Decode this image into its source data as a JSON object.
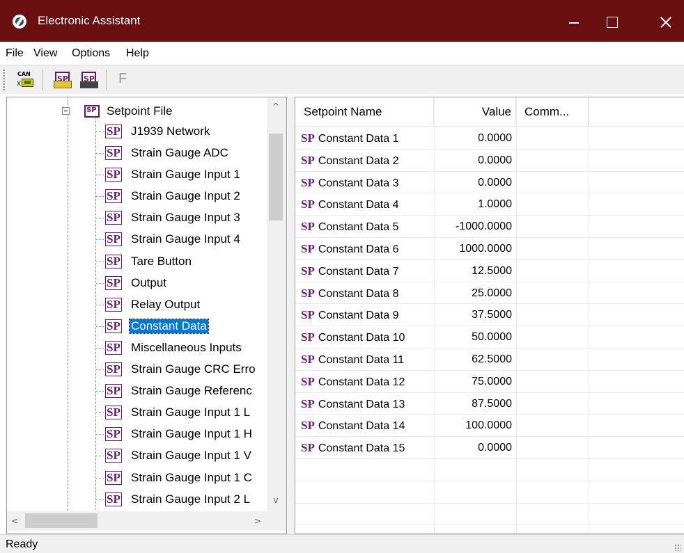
{
  "window": {
    "title": "Electronic Assistant",
    "controls": {
      "minimize": "minimize",
      "maximize": "maximize",
      "close": "close"
    }
  },
  "menu": [
    "File",
    "View",
    "Options",
    "Help"
  ],
  "toolbar": {
    "can_label": "CAN",
    "sp_icon_text": "SP",
    "f_label": "F"
  },
  "tree": {
    "root": {
      "label": "Setpoint File",
      "icon_text": "SP"
    },
    "tag": "SP",
    "items": [
      {
        "label": "J1939 Network"
      },
      {
        "label": "Strain Gauge ADC"
      },
      {
        "label": "Strain Gauge Input 1"
      },
      {
        "label": "Strain Gauge Input 2"
      },
      {
        "label": "Strain Gauge Input 3"
      },
      {
        "label": "Strain Gauge Input 4"
      },
      {
        "label": "Tare Button"
      },
      {
        "label": "Output"
      },
      {
        "label": "Relay Output"
      },
      {
        "label": "Constant Data",
        "selected": true
      },
      {
        "label": "Miscellaneous Inputs"
      },
      {
        "label": "Strain Gauge CRC Erro"
      },
      {
        "label": "Strain Gauge Referenc"
      },
      {
        "label": "Strain Gauge Input 1 L"
      },
      {
        "label": "Strain Gauge Input 1 H"
      },
      {
        "label": "Strain Gauge Input 1 V"
      },
      {
        "label": "Strain Gauge Input 1 C"
      },
      {
        "label": "Strain Gauge Input 2 L"
      }
    ],
    "scroll": {
      "up": "^",
      "down": "v",
      "left": "<",
      "right": ">"
    }
  },
  "list": {
    "columns": [
      "Setpoint Name",
      "Value",
      "Comm..."
    ],
    "tag": "SP",
    "rows": [
      {
        "name": "Constant Data 1",
        "value": "0.0000"
      },
      {
        "name": "Constant Data 2",
        "value": "0.0000"
      },
      {
        "name": "Constant Data 3",
        "value": "0.0000"
      },
      {
        "name": "Constant Data 4",
        "value": "1.0000"
      },
      {
        "name": "Constant Data 5",
        "value": "-1000.0000"
      },
      {
        "name": "Constant Data 6",
        "value": "1000.0000"
      },
      {
        "name": "Constant Data 7",
        "value": "12.5000"
      },
      {
        "name": "Constant Data 8",
        "value": "25.0000"
      },
      {
        "name": "Constant Data 9",
        "value": "37.5000"
      },
      {
        "name": "Constant Data 10",
        "value": "50.0000"
      },
      {
        "name": "Constant Data 11",
        "value": "62.5000"
      },
      {
        "name": "Constant Data 12",
        "value": "75.0000"
      },
      {
        "name": "Constant Data 13",
        "value": "87.5000"
      },
      {
        "name": "Constant Data 14",
        "value": "100.0000"
      },
      {
        "name": "Constant Data 15",
        "value": "0.0000"
      }
    ]
  },
  "status": {
    "text": "Ready"
  },
  "colors": {
    "titlebar": "#6b1010",
    "selection": "#0078d7",
    "sp_tag": "#6a1a7a"
  }
}
